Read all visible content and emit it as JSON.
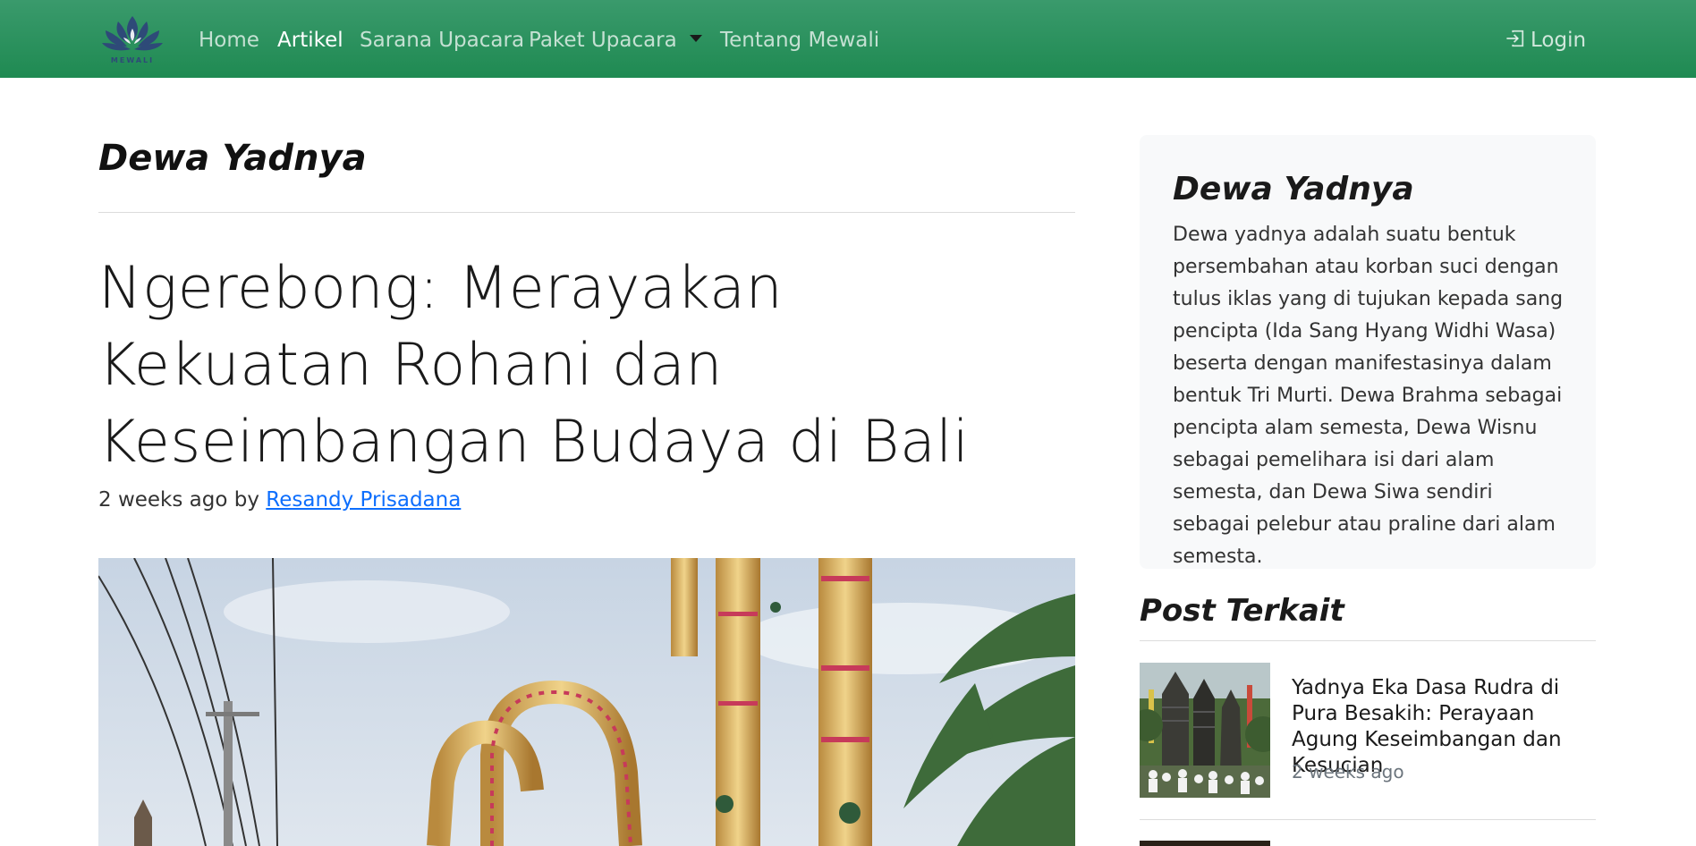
{
  "navbar": {
    "logo_text": "MEWALI",
    "items": [
      {
        "label": "Home"
      },
      {
        "label": "Artikel"
      },
      {
        "label": "Sarana Upacara"
      },
      {
        "label": "Paket Upacara"
      },
      {
        "label": "Tentang Mewali"
      }
    ],
    "login_label": "Login",
    "colors": {
      "bar": "#1f8a52",
      "bar_top": "#3a9a6c"
    }
  },
  "main": {
    "category_title": "Dewa Yadnya",
    "article_title": "Ngerebong: Merayakan Kekuatan Rohani dan Keseimbangan Budaya di Bali",
    "meta_prefix": "2 weeks ago by",
    "author": "Resandy Prisadana"
  },
  "sidebar": {
    "card_title": "Dewa Yadnya",
    "card_text": "Dewa yadnya adalah suatu bentuk persembahan atau korban suci dengan tulus iklas yang di tujukan kepada sang pencipta (Ida Sang Hyang Widhi Wasa) beserta dengan manifestasinya dalam bentuk Tri Murti. Dewa Brahma sebagai pencipta alam semesta, Dewa Wisnu sebagai pemelihara isi dari alam semesta, dan Dewa Siwa sendiri sebagai pelebur atau praline dari alam semesta.",
    "related_heading": "Post Terkait",
    "related_posts": [
      {
        "title": "Yadnya Eka Dasa Rudra di Pura Besakih: Perayaan Agung Keseimbangan dan Kesucian",
        "time": "2 weeks ago"
      }
    ]
  }
}
